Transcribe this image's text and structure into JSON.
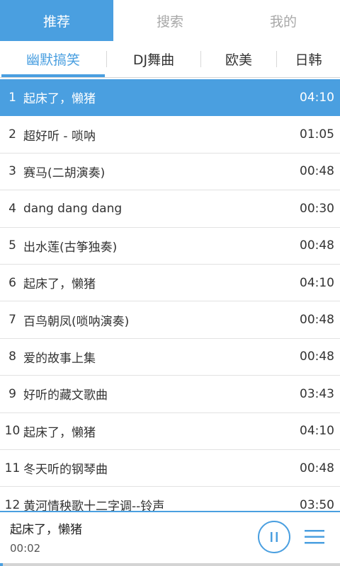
{
  "top_tabs": [
    {
      "label": "推荐"
    },
    {
      "label": "搜索"
    },
    {
      "label": "我的"
    }
  ],
  "sub_tabs": [
    {
      "label": "幽默搞笑"
    },
    {
      "label": "DJ舞曲"
    },
    {
      "label": "欧美"
    },
    {
      "label": "日韩"
    }
  ],
  "songs": [
    {
      "num": "1",
      "title": "起床了，懒猪",
      "duration": "04:10"
    },
    {
      "num": "2",
      "title": "超好听 - 唢呐",
      "duration": "01:05"
    },
    {
      "num": "3",
      "title": "赛马(二胡演奏)",
      "duration": "00:48"
    },
    {
      "num": "4",
      "title": "dang dang dang",
      "duration": "00:30"
    },
    {
      "num": "5",
      "title": "出水莲(古筝独奏)",
      "duration": "00:48"
    },
    {
      "num": "6",
      "title": "起床了，懒猪",
      "duration": "04:10"
    },
    {
      "num": "7",
      "title": "百鸟朝凤(唢呐演奏)",
      "duration": "00:48"
    },
    {
      "num": "8",
      "title": "爱的故事上集",
      "duration": "00:48"
    },
    {
      "num": "9",
      "title": "好听的藏文歌曲",
      "duration": "03:43"
    },
    {
      "num": "10",
      "title": "起床了，懒猪",
      "duration": "04:10"
    },
    {
      "num": "11",
      "title": "冬天听的钢琴曲",
      "duration": "00:48"
    },
    {
      "num": "12",
      "title": "黄河情秧歌十二字调--铃声",
      "duration": "03:50"
    }
  ],
  "player": {
    "title": "起床了，懒猪",
    "elapsed": "00:02",
    "progress_fraction": 0.008
  },
  "icons": {
    "pause": "pause-icon",
    "menu": "menu-icon"
  },
  "colors": {
    "accent": "#4a9fe0",
    "inactive_text": "#a8a8a8"
  }
}
